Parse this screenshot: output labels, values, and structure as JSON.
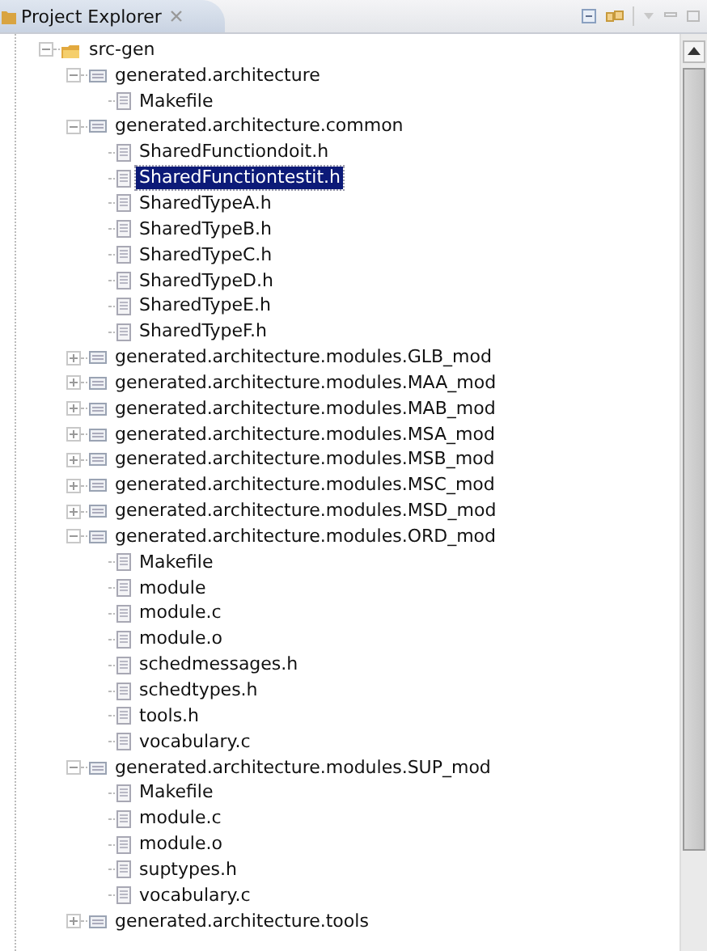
{
  "view": {
    "title": "Project Explorer"
  },
  "tree": [
    {
      "label": "src-gen",
      "kind": "source-folder",
      "expanded": true,
      "selected": false,
      "children": [
        {
          "label": "generated.architecture",
          "kind": "package",
          "expanded": true,
          "selected": false,
          "children": [
            {
              "label": "Makefile",
              "kind": "file",
              "selected": false
            }
          ]
        },
        {
          "label": "generated.architecture.common",
          "kind": "package",
          "expanded": true,
          "selected": false,
          "children": [
            {
              "label": "SharedFunctiondoit.h",
              "kind": "file",
              "selected": false
            },
            {
              "label": "SharedFunctiontestit.h",
              "kind": "file",
              "selected": true
            },
            {
              "label": "SharedTypeA.h",
              "kind": "file",
              "selected": false
            },
            {
              "label": "SharedTypeB.h",
              "kind": "file",
              "selected": false
            },
            {
              "label": "SharedTypeC.h",
              "kind": "file",
              "selected": false
            },
            {
              "label": "SharedTypeD.h",
              "kind": "file",
              "selected": false
            },
            {
              "label": "SharedTypeE.h",
              "kind": "file",
              "selected": false
            },
            {
              "label": "SharedTypeF.h",
              "kind": "file",
              "selected": false
            }
          ]
        },
        {
          "label": "generated.architecture.modules.GLB_mod",
          "kind": "package",
          "expanded": false,
          "selected": false
        },
        {
          "label": "generated.architecture.modules.MAA_mod",
          "kind": "package",
          "expanded": false,
          "selected": false
        },
        {
          "label": "generated.architecture.modules.MAB_mod",
          "kind": "package",
          "expanded": false,
          "selected": false
        },
        {
          "label": "generated.architecture.modules.MSA_mod",
          "kind": "package",
          "expanded": false,
          "selected": false
        },
        {
          "label": "generated.architecture.modules.MSB_mod",
          "kind": "package",
          "expanded": false,
          "selected": false
        },
        {
          "label": "generated.architecture.modules.MSC_mod",
          "kind": "package",
          "expanded": false,
          "selected": false
        },
        {
          "label": "generated.architecture.modules.MSD_mod",
          "kind": "package",
          "expanded": false,
          "selected": false
        },
        {
          "label": "generated.architecture.modules.ORD_mod",
          "kind": "package",
          "expanded": true,
          "selected": false,
          "children": [
            {
              "label": "Makefile",
              "kind": "file",
              "selected": false
            },
            {
              "label": "module",
              "kind": "file",
              "selected": false
            },
            {
              "label": "module.c",
              "kind": "file",
              "selected": false
            },
            {
              "label": "module.o",
              "kind": "file",
              "selected": false
            },
            {
              "label": "schedmessages.h",
              "kind": "file",
              "selected": false
            },
            {
              "label": "schedtypes.h",
              "kind": "file",
              "selected": false
            },
            {
              "label": "tools.h",
              "kind": "file",
              "selected": false
            },
            {
              "label": "vocabulary.c",
              "kind": "file",
              "selected": false
            }
          ]
        },
        {
          "label": "generated.architecture.modules.SUP_mod",
          "kind": "package",
          "expanded": true,
          "selected": false,
          "children": [
            {
              "label": "Makefile",
              "kind": "file",
              "selected": false
            },
            {
              "label": "module.c",
              "kind": "file",
              "selected": false
            },
            {
              "label": "module.o",
              "kind": "file",
              "selected": false
            },
            {
              "label": "suptypes.h",
              "kind": "file",
              "selected": false
            },
            {
              "label": "vocabulary.c",
              "kind": "file",
              "selected": false
            }
          ]
        },
        {
          "label": "generated.architecture.tools",
          "kind": "package",
          "expanded": false,
          "selected": false
        }
      ]
    }
  ]
}
